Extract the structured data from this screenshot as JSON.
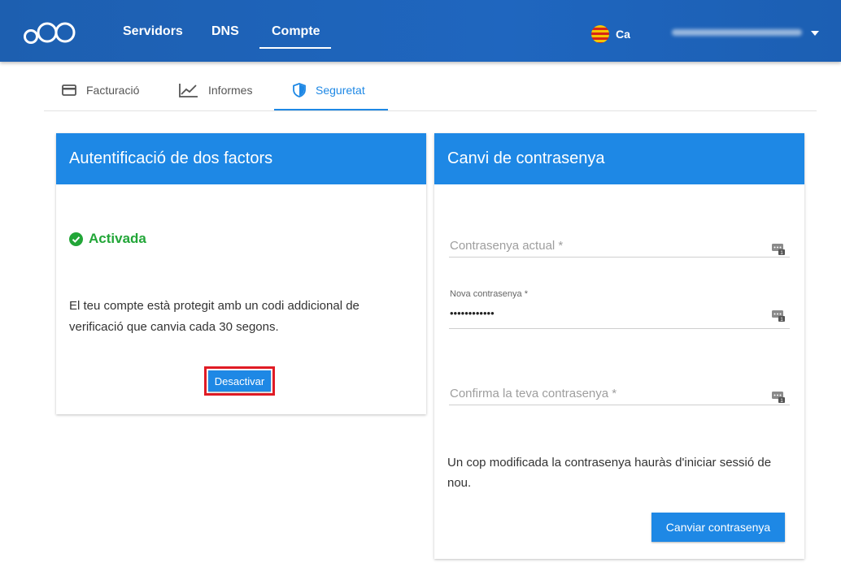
{
  "topbar": {
    "nav": [
      "Servidors",
      "DNS",
      "Compte"
    ],
    "active_nav": "Compte",
    "language": "Ca",
    "user_name_blurred": true
  },
  "tabs": [
    {
      "label": "Facturació",
      "icon": "credit-card-icon"
    },
    {
      "label": "Informes",
      "icon": "chart-line-icon"
    },
    {
      "label": "Seguretat",
      "icon": "shield-icon"
    }
  ],
  "active_tab": "Seguretat",
  "two_factor": {
    "title": "Autentificació de dos factors",
    "status": "Activada",
    "description": "El teu compte està protegit amb un codi addicional de verificació que canvia cada 30 segons.",
    "deactivate_label": "Desactivar"
  },
  "password": {
    "title": "Canvi de contrasenya",
    "current_placeholder": "Contrasenya actual *",
    "new_label": "Nova contrasenya *",
    "new_value": "••••••••••••",
    "confirm_placeholder": "Confirma la teva contrasenya *",
    "note": "Un cop modificada la contrasenya hauràs d'iniciar sessió de nou.",
    "change_label": "Canviar contrasenya"
  },
  "colors": {
    "header_blue": "#1e66c0",
    "accent": "#1e88e5",
    "success": "#22a638",
    "highlight": "#e01b24"
  }
}
